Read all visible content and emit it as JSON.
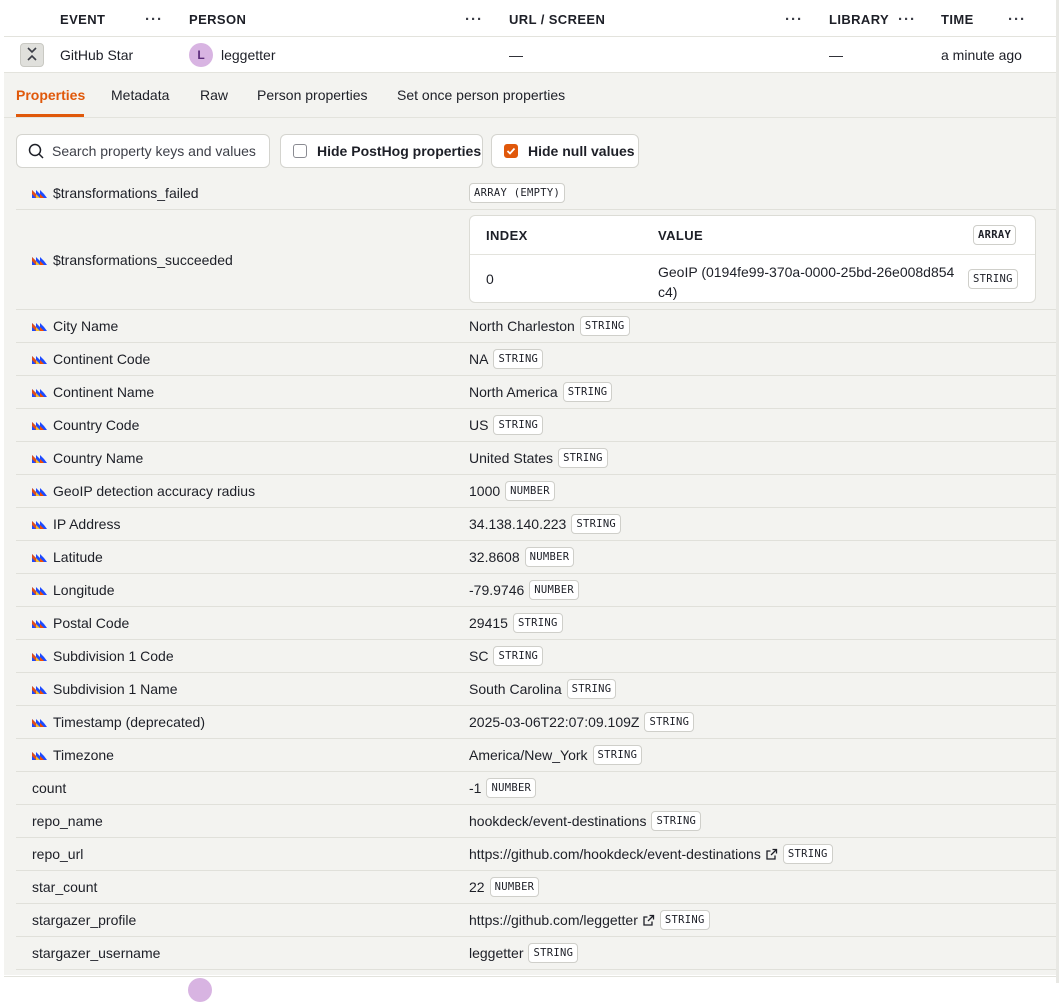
{
  "columns": {
    "event": "EVENT",
    "person": "PERSON",
    "url": "URL / SCREEN",
    "library": "LIBRARY",
    "time": "TIME",
    "menu_glyph": "···"
  },
  "event_row": {
    "event": "GitHub Star",
    "person_initial": "L",
    "person": "leggetter",
    "url": "—",
    "library": "—",
    "time": "a minute ago"
  },
  "tabs": [
    "Properties",
    "Metadata",
    "Raw",
    "Person properties",
    "Set once person properties"
  ],
  "filters": {
    "search_placeholder": "Search property keys and values",
    "hide_posthog": "Hide PostHog properties",
    "hide_posthog_checked": false,
    "hide_null": "Hide null values",
    "hide_null_checked": true
  },
  "array_table": {
    "index_header": "INDEX",
    "value_header": "VALUE",
    "type": "ARRAY",
    "rows": [
      {
        "index": "0",
        "value_line1": "GeoIP (0194fe99-370a-0000-25bd-26e008d854",
        "value_line2": "c4)",
        "type": "STRING"
      }
    ]
  },
  "properties": [
    {
      "key": "$transformations_failed",
      "posthog": true,
      "value": "",
      "type": "ARRAY (EMPTY)"
    },
    {
      "key": "$transformations_succeeded",
      "posthog": true,
      "array": true
    },
    {
      "key": "City Name",
      "posthog": true,
      "value": "North Charleston",
      "type": "STRING"
    },
    {
      "key": "Continent Code",
      "posthog": true,
      "value": "NA",
      "type": "STRING"
    },
    {
      "key": "Continent Name",
      "posthog": true,
      "value": "North America",
      "type": "STRING"
    },
    {
      "key": "Country Code",
      "posthog": true,
      "value": "US",
      "type": "STRING"
    },
    {
      "key": "Country Name",
      "posthog": true,
      "value": "United States",
      "type": "STRING"
    },
    {
      "key": "GeoIP detection accuracy radius",
      "posthog": true,
      "value": "1000",
      "type": "NUMBER"
    },
    {
      "key": "IP Address",
      "posthog": true,
      "value": "34.138.140.223",
      "type": "STRING"
    },
    {
      "key": "Latitude",
      "posthog": true,
      "value": "32.8608",
      "type": "NUMBER"
    },
    {
      "key": "Longitude",
      "posthog": true,
      "value": "-79.9746",
      "type": "NUMBER"
    },
    {
      "key": "Postal Code",
      "posthog": true,
      "value": "29415",
      "type": "STRING"
    },
    {
      "key": "Subdivision 1 Code",
      "posthog": true,
      "value": "SC",
      "type": "STRING"
    },
    {
      "key": "Subdivision 1 Name",
      "posthog": true,
      "value": "South Carolina",
      "type": "STRING"
    },
    {
      "key": "Timestamp (deprecated)",
      "posthog": true,
      "value": "2025-03-06T22:07:09.109Z",
      "type": "STRING"
    },
    {
      "key": "Timezone",
      "posthog": true,
      "value": "America/New_York",
      "type": "STRING"
    },
    {
      "key": "count",
      "posthog": false,
      "value": "-1",
      "type": "NUMBER"
    },
    {
      "key": "repo_name",
      "posthog": false,
      "value": "hookdeck/event-destinations",
      "type": "STRING"
    },
    {
      "key": "repo_url",
      "posthog": false,
      "value": "https://github.com/hookdeck/event-destinations",
      "type": "STRING",
      "link": true
    },
    {
      "key": "star_count",
      "posthog": false,
      "value": "22",
      "type": "NUMBER"
    },
    {
      "key": "stargazer_profile",
      "posthog": false,
      "value": "https://github.com/leggetter",
      "type": "STRING",
      "link": true
    },
    {
      "key": "stargazer_username",
      "posthog": false,
      "value": "leggetter",
      "type": "STRING"
    }
  ],
  "icons": {
    "posthog": "posthog-logo-icon",
    "external": "external-link-icon",
    "search": "search-icon",
    "collapse": "collapse-icon",
    "check": "check-icon"
  },
  "colors": {
    "accent": "#e0580a",
    "avatar_bg": "#d8b4e2",
    "panel_bg": "#f3f3f0"
  }
}
